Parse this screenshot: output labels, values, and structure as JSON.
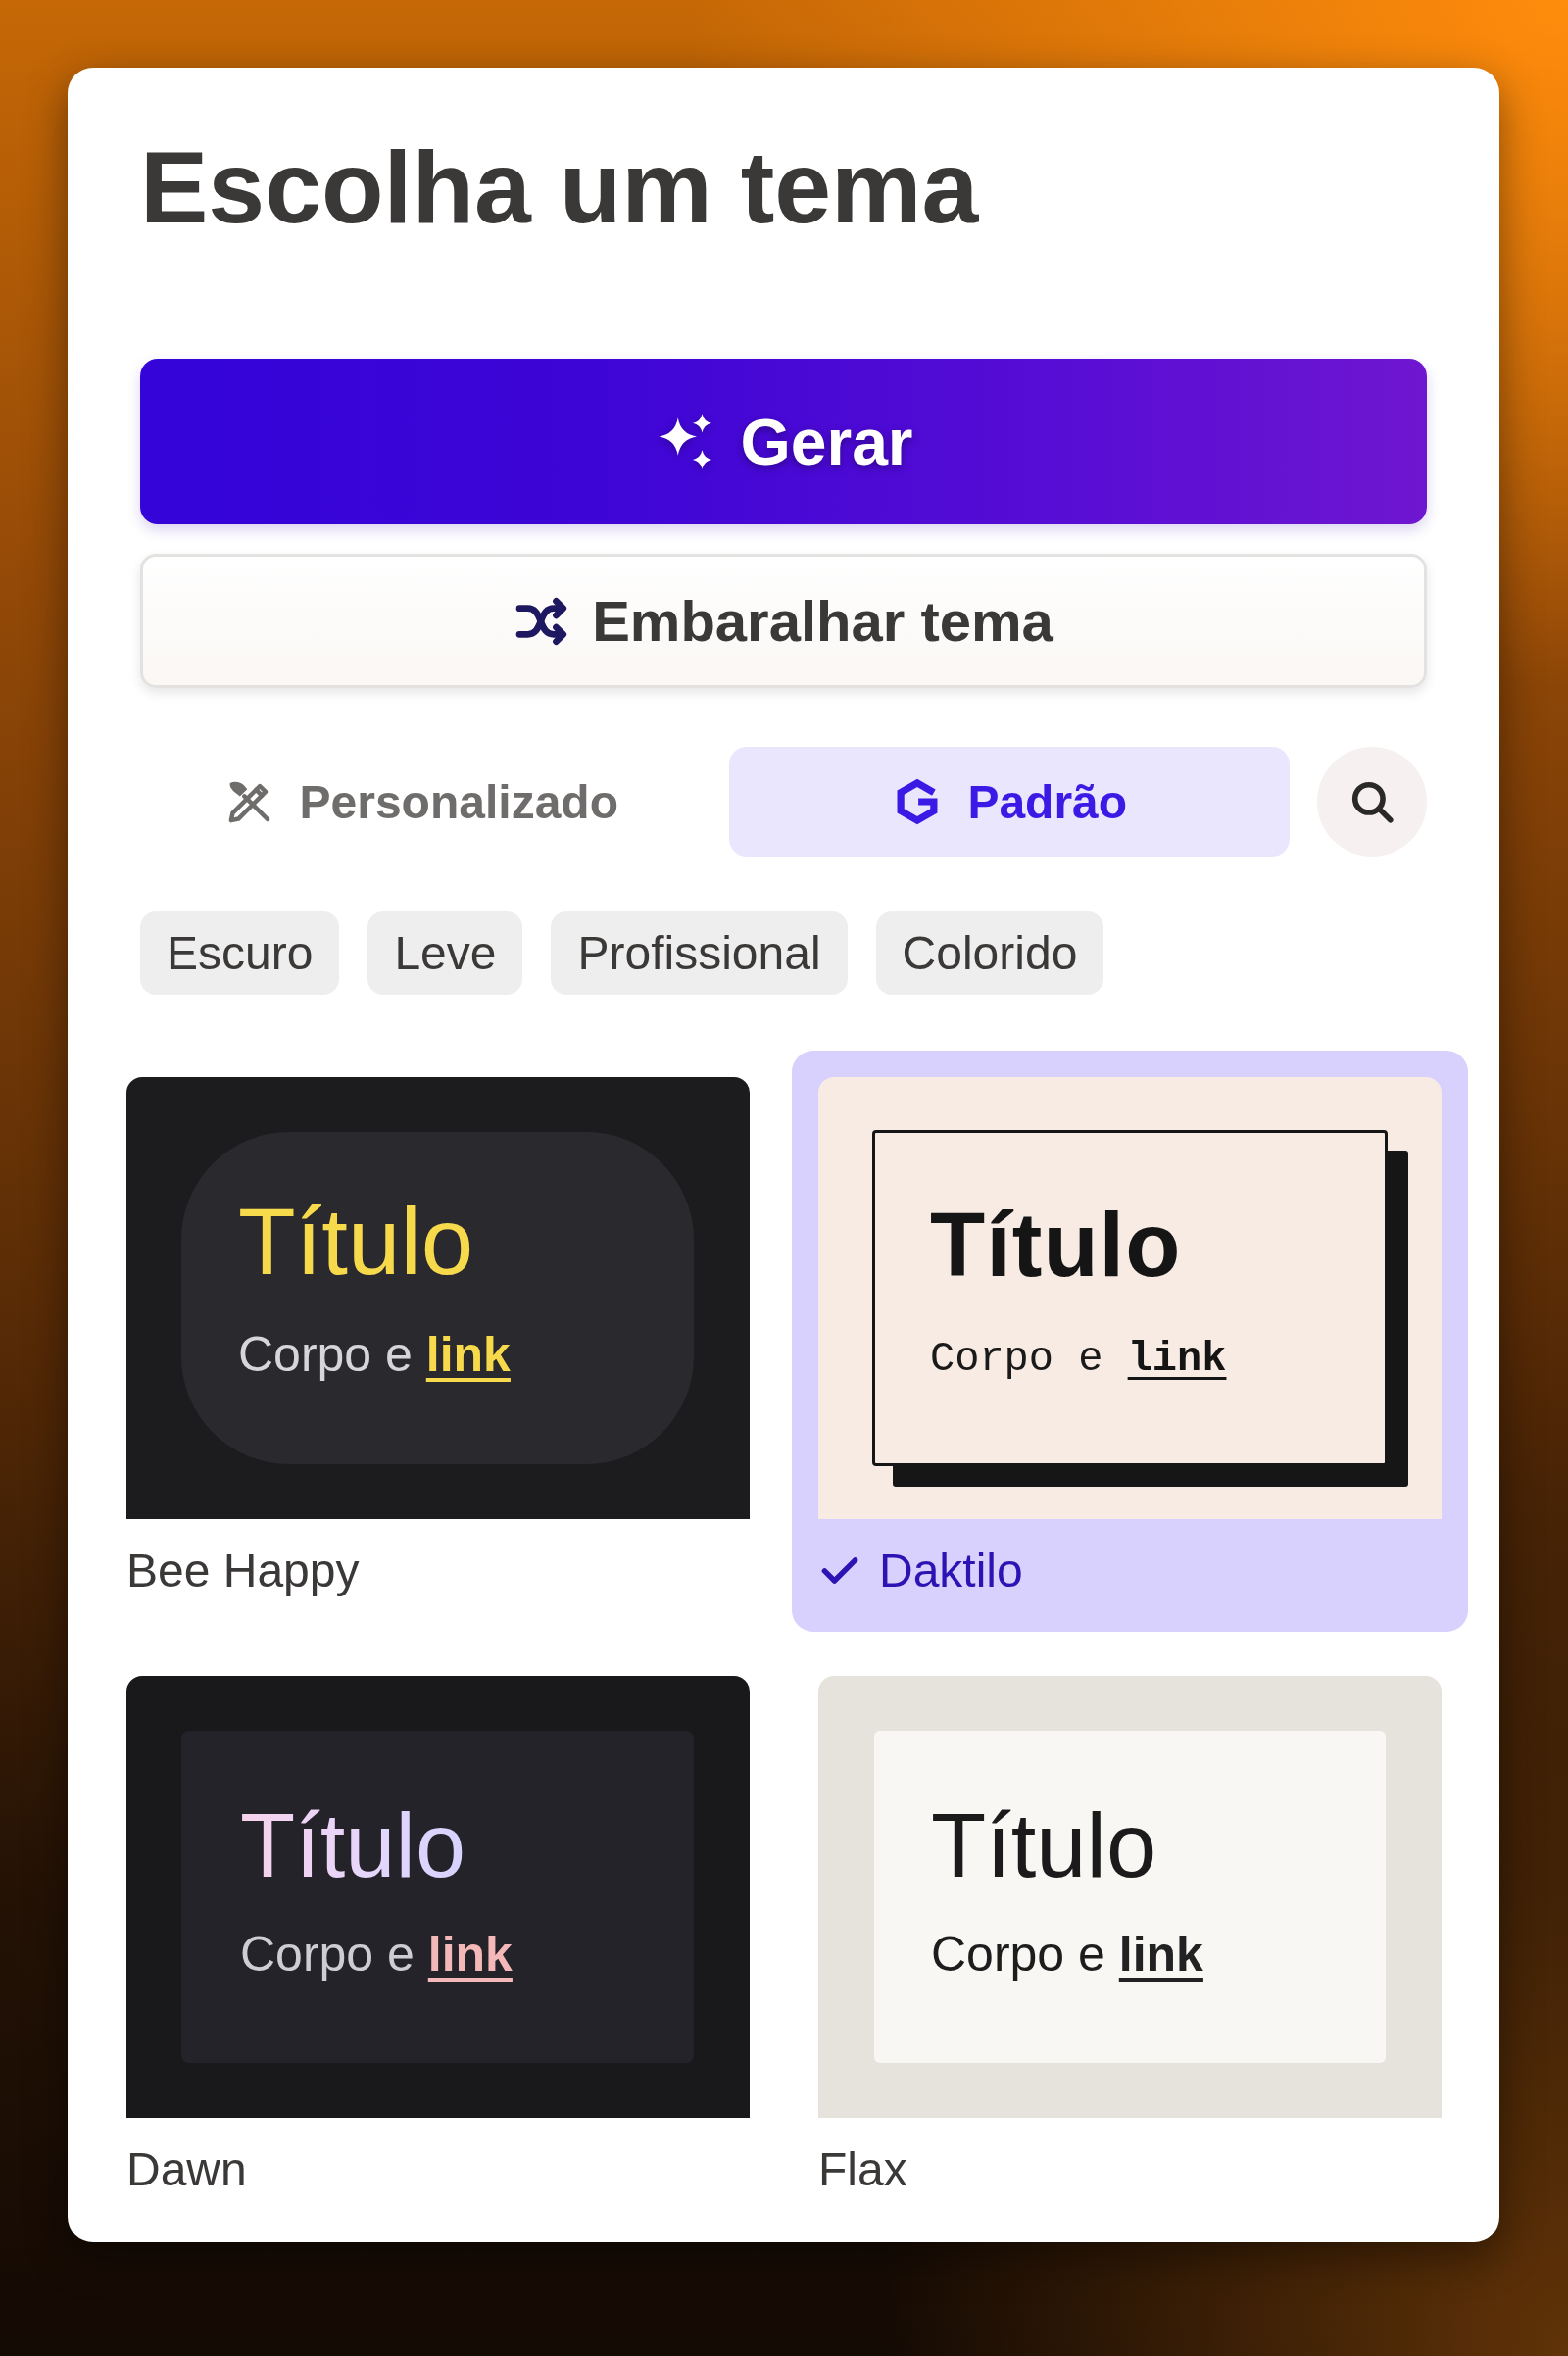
{
  "title": "Escolha um tema",
  "actions": [
    {
      "kind": "generate",
      "label": "Gerar"
    },
    {
      "kind": "shuffle",
      "label": "Embaralhar tema"
    }
  ],
  "tabs": [
    {
      "label": "Personalizado",
      "selected": false
    },
    {
      "label": "Padrão",
      "selected": true
    }
  ],
  "filters": [
    {
      "label": "Escuro",
      "selected": false
    },
    {
      "label": "Leve",
      "selected": false
    },
    {
      "label": "Profissional",
      "selected": false
    },
    {
      "label": "Colorido",
      "selected": false
    }
  ],
  "themes": [
    {
      "name": "Bee Happy",
      "kind": "rounded",
      "selected": false,
      "preview": {
        "title": "Título",
        "body": "Corpo e",
        "link": "link"
      }
    },
    {
      "name": "Daktilo",
      "kind": "offset",
      "selected": true,
      "preview": {
        "title": "Título",
        "body": "Corpo e",
        "link": "link"
      }
    },
    {
      "name": "Dawn",
      "kind": "gradient",
      "selected": false,
      "preview": {
        "title": "Título",
        "body": "Corpo e",
        "link": "link"
      }
    },
    {
      "name": "Flax",
      "kind": "framed",
      "selected": false,
      "preview": {
        "title": "Título",
        "body": "Corpo e",
        "link": "link"
      }
    }
  ]
}
